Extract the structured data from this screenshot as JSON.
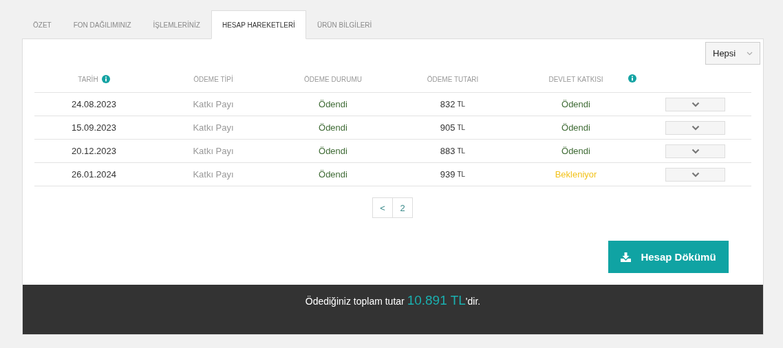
{
  "tabs": [
    {
      "label": "ÖZET",
      "selected": false
    },
    {
      "label": "FON DAĞILIMINIZ",
      "selected": false
    },
    {
      "label": "İŞLEMLERİNİZ",
      "selected": false
    },
    {
      "label": "HESAP HAREKETLERİ",
      "selected": true
    },
    {
      "label": "ÜRÜN BİLGİLERİ",
      "selected": false
    }
  ],
  "filter": {
    "value": "Hepsi"
  },
  "table": {
    "columns": [
      {
        "label": "TARİH",
        "info": true
      },
      {
        "label": "ÖDEME TİPİ",
        "info": false
      },
      {
        "label": "ÖDEME DURUMU",
        "info": false
      },
      {
        "label": "ÖDEME TUTARI",
        "info": false
      },
      {
        "label": "DEVLET KATKISI",
        "info": true
      }
    ],
    "rows": [
      {
        "date": "24.08.2023",
        "type": "Katkı Payı",
        "status": {
          "text": "Ödendi",
          "color": "#3f6b35"
        },
        "amount": "832",
        "currency": "TL",
        "state_contribution": {
          "text": "Ödendi",
          "color": "#3f6b35"
        }
      },
      {
        "date": "15.09.2023",
        "type": "Katkı Payı",
        "status": {
          "text": "Ödendi",
          "color": "#3f6b35"
        },
        "amount": "905",
        "currency": "TL",
        "state_contribution": {
          "text": "Ödendi",
          "color": "#3f6b35"
        }
      },
      {
        "date": "20.12.2023",
        "type": "Katkı Payı",
        "status": {
          "text": "Ödendi",
          "color": "#3f6b35"
        },
        "amount": "883",
        "currency": "TL",
        "state_contribution": {
          "text": "Ödendi",
          "color": "#3f6b35"
        }
      },
      {
        "date": "26.01.2024",
        "type": "Katkı Payı",
        "status": {
          "text": "Ödendi",
          "color": "#3f6b35"
        },
        "amount": "939",
        "currency": "TL",
        "state_contribution": {
          "text": "Bekleniyor",
          "color": "#f2c21b"
        }
      }
    ]
  },
  "pagination": [
    "<",
    "2"
  ],
  "download_button": {
    "label": "Hesap Dökümü"
  },
  "footer": {
    "prefix": "Ödediğiniz toplam tutar",
    "amount": "10.891 TL",
    "suffix": "'dir."
  }
}
